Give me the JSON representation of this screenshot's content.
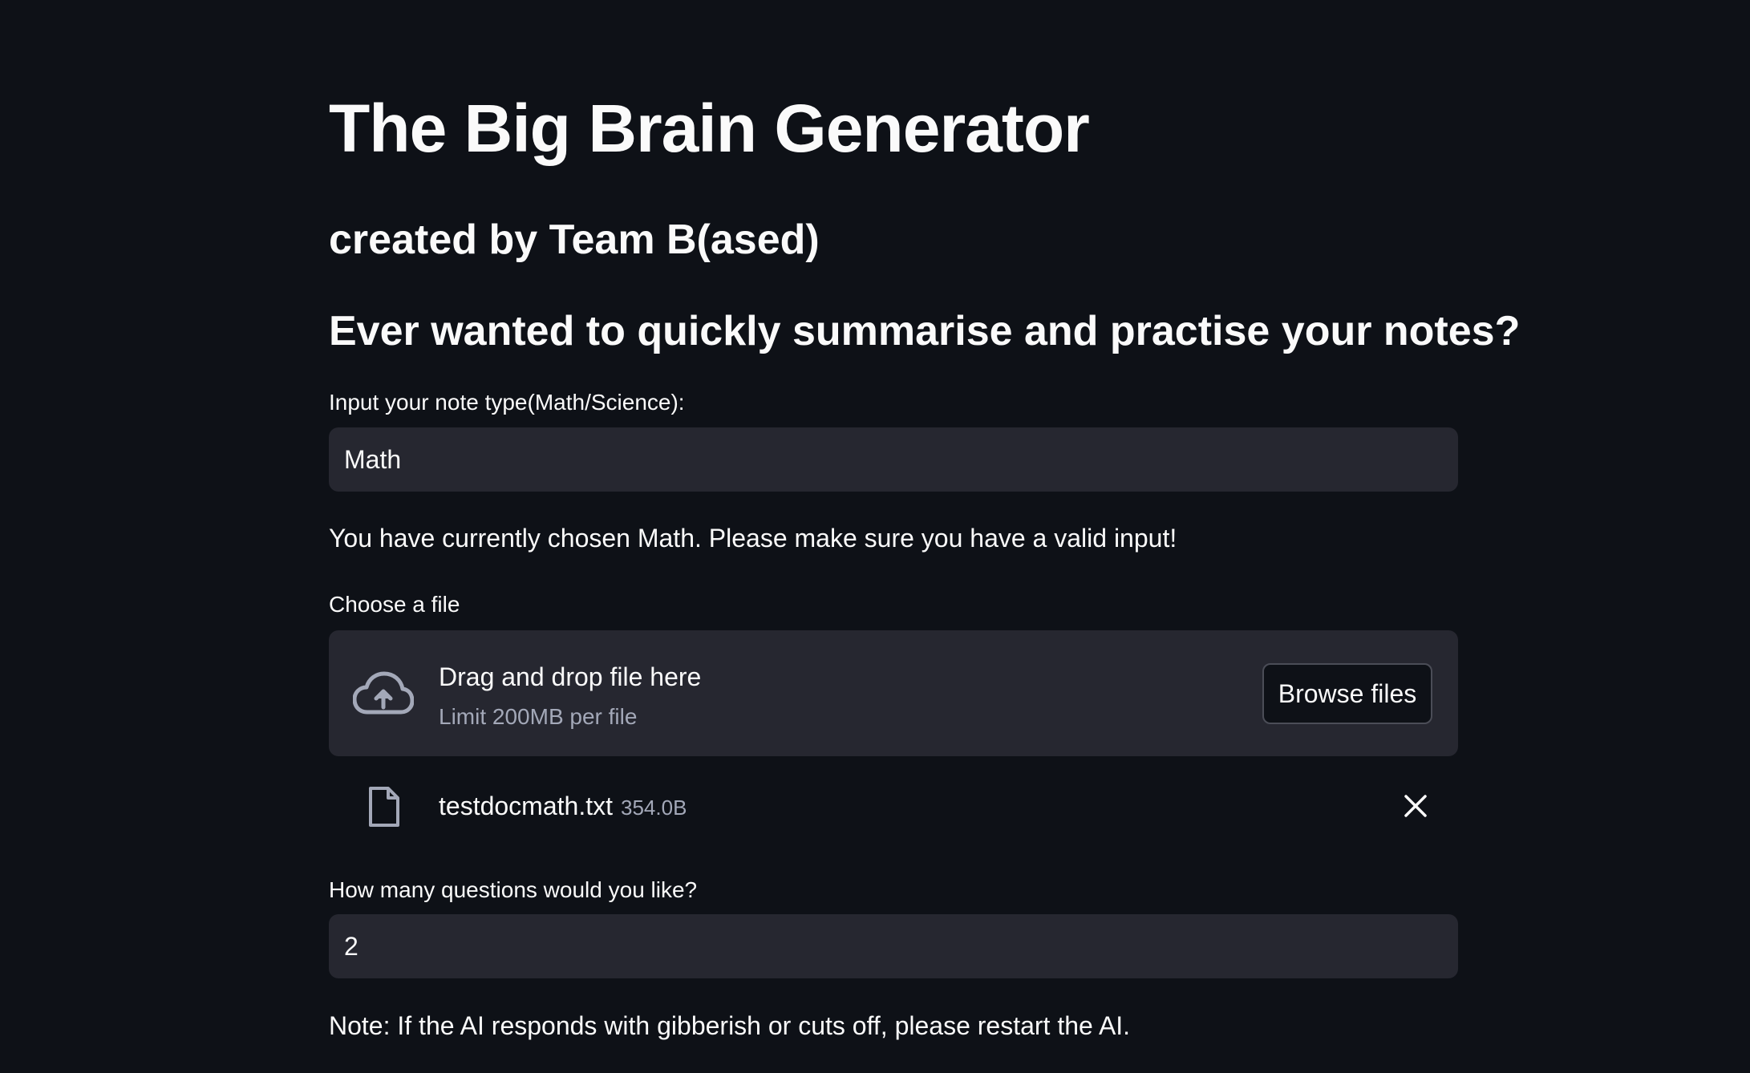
{
  "header": {
    "title": "The Big Brain Generator",
    "subtitle": "created by Team B(ased)",
    "heading": "Ever wanted to quickly summarise and practise your notes?"
  },
  "note_type": {
    "label": "Input your note type(Math/Science):",
    "value": "Math",
    "info": "You have currently chosen Math. Please make sure you have a valid input!"
  },
  "uploader": {
    "label": "Choose a file",
    "drop_text": "Drag and drop file here",
    "limit_text": "Limit 200MB per file",
    "browse_label": "Browse files",
    "upload_icon": "cloud-upload-icon",
    "file": {
      "name": "testdocmath.txt",
      "size": "354.0B",
      "icon": "file-icon",
      "remove_icon": "close-icon"
    }
  },
  "questions": {
    "label": "How many questions would you like?",
    "value": "2"
  },
  "note": "Note: If the AI responds with gibberish or cuts off, please restart the AI.",
  "colors": {
    "background": "#0e1117",
    "input_background": "#262730",
    "text": "#fafafa",
    "muted_text": "#a3a8b8",
    "button_border": "#4b4d57"
  }
}
